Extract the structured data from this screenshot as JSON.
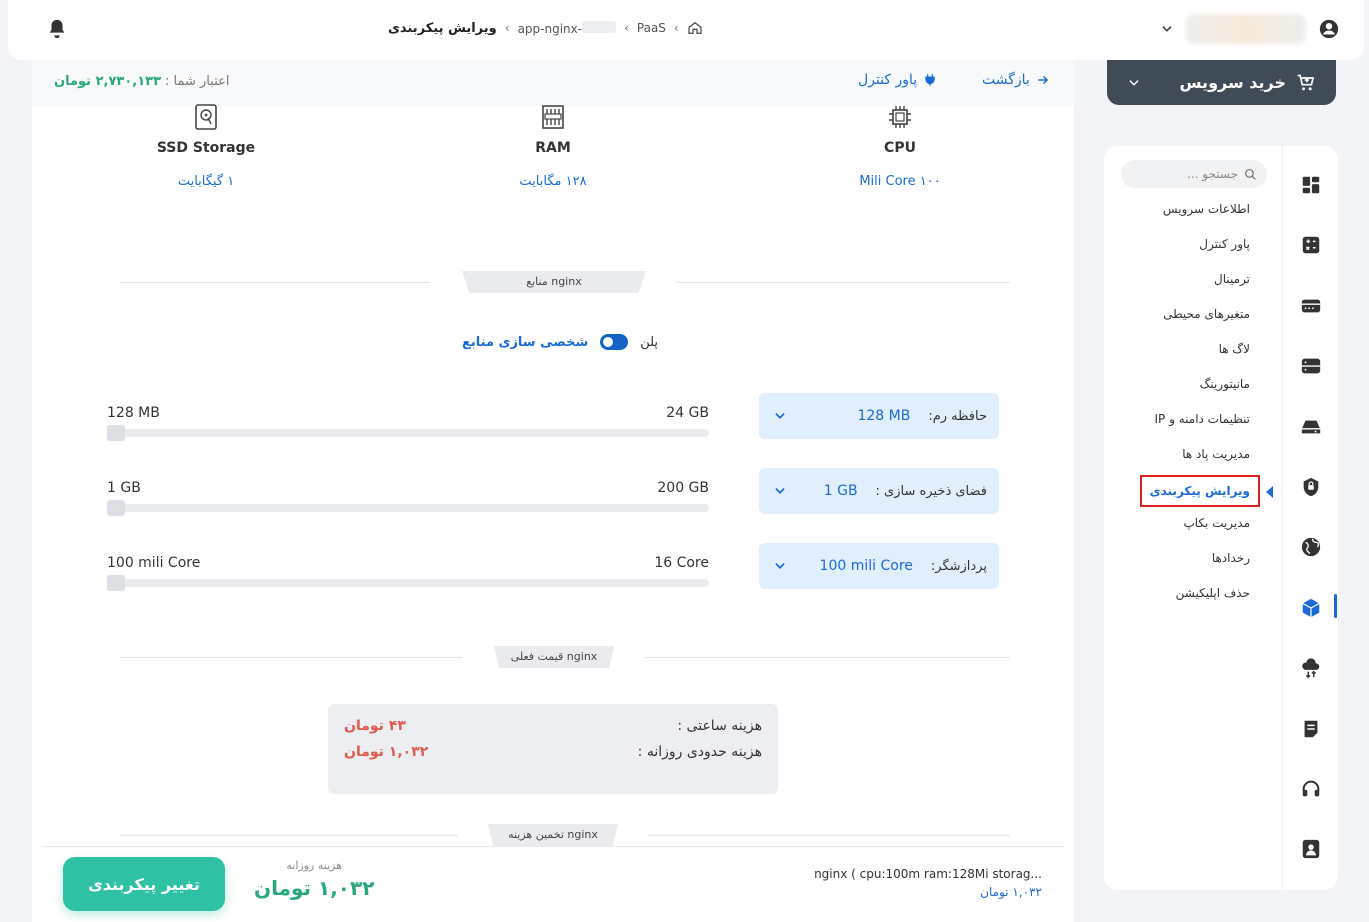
{
  "topbar": {
    "breadcrumb": {
      "paas": "PaaS",
      "app": "app-nginx-",
      "current": "ویرایش پیکربندی"
    }
  },
  "header": {
    "credit_label": "اعتبار شما :",
    "credit_amount": "۲,۷۳۰,۱۳۳ تومان",
    "power_control": "پاور کنترل",
    "back": "بازگشت"
  },
  "specs": {
    "storage": {
      "name": "SSD Storage",
      "value": "۱ گیگابایت"
    },
    "ram": {
      "name": "RAM",
      "value": "۱۲۸ مگابایت"
    },
    "cpu": {
      "name": "CPU",
      "value": "۱۰۰ Mili Core"
    }
  },
  "sections": {
    "resources": "منابع nginx",
    "current_price": "قیمت فعلی nginx",
    "estimate": "تخمین هزینه nginx"
  },
  "toggle": {
    "plan_label": "پلن",
    "custom_label": "شخصی سازی منابع",
    "enabled": true
  },
  "resources": [
    {
      "label": "حافظه رم:",
      "value": "128 MB",
      "min": "128 MB",
      "max": "24 GB",
      "fill": 0.0
    },
    {
      "label": "فضای ذخیره سازی :",
      "value": "1 GB",
      "min": "1 GB",
      "max": "200 GB",
      "fill": 0.0
    },
    {
      "label": "پردازشگر:",
      "value": "100 mili Core",
      "min": "100 mili Core",
      "max": "16 Core",
      "fill": 0.0
    }
  ],
  "pricing": {
    "hourly_label": "هزینه ساعتی :",
    "hourly_value": "۴۳ تومان",
    "daily_label": "هزینه حدودی روزانه :",
    "daily_value": "۱,۰۳۲ تومان"
  },
  "footer": {
    "button": "تغییر پیکربندی",
    "daily_label": "هزینه روزانه",
    "daily_value": "۱,۰۳۲ تومان",
    "summary": "nginx ( cpu:100m ram:128Mi storag...",
    "summary_price": "۱,۰۳۲ تومان"
  },
  "buy": {
    "label": "خرید سرویس"
  },
  "sidebar": {
    "search_placeholder": "جستجو ...",
    "items": [
      {
        "label": "اطلاعات سرویس"
      },
      {
        "label": "پاور کنترل"
      },
      {
        "label": "ترمینال"
      },
      {
        "label": "متغیرهای محیطی"
      },
      {
        "label": "لاگ ها"
      },
      {
        "label": "مانیتورینگ"
      },
      {
        "label": "تنظیمات دامنه و IP"
      },
      {
        "label": "مدیریت پاد ها"
      },
      {
        "label": "ویرایش پیکربندی"
      },
      {
        "label": "مدیریت بکاپ"
      },
      {
        "label": "رخدادها"
      },
      {
        "label": "حذف اپلیکیشن"
      }
    ],
    "active_index": 8
  },
  "colors": {
    "accent": "#1a6bd6",
    "success": "#2fc1a3",
    "danger": "#e05a4d",
    "dark": "#3f4b57"
  }
}
